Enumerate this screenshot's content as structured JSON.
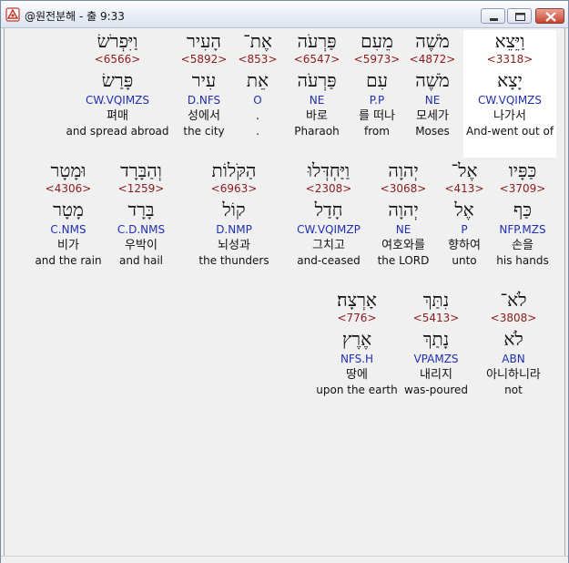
{
  "window": {
    "title": "@원전분해 - 출 9:33"
  },
  "rows": [
    [
      {
        "heb": "וַיֵּצֵא",
        "strong": "<3318>",
        "lex": "יָצָא",
        "parse": "CW.VQIMZS",
        "kor": "나가서",
        "eng": "And-went out of",
        "highlight": true
      },
      {
        "heb": "מֹשֶׁה",
        "strong": "<4872>",
        "lex": "מֹשֶׁה",
        "parse": "NE",
        "kor": "모세가",
        "eng": "Moses"
      },
      {
        "heb": "מֵעִם",
        "strong": "<5973>",
        "lex": "עִם",
        "parse": "P.P",
        "kor": "를 떠나",
        "eng": "from"
      },
      {
        "heb": "פַּרְעֹה",
        "strong": "<6547>",
        "lex": "פַּרְעֹה",
        "parse": "NE",
        "kor": "바로",
        "eng": "Pharaoh"
      },
      {
        "heb": "אֶת־",
        "strong": "<853>",
        "lex": "אֵת",
        "parse": "O",
        "kor": ".",
        "eng": "."
      },
      {
        "heb": "הָעִיר",
        "strong": "<5892>",
        "lex": "עִיר",
        "parse": "D.NFS",
        "kor": "성에서",
        "eng": "the city"
      },
      {
        "heb": "וַיִּפְרֹשׂ",
        "strong": "<6566>",
        "lex": "פָּרַשׂ",
        "parse": "CW.VQIMZS",
        "kor": "펴매",
        "eng": "and spread abroad"
      }
    ],
    [
      {
        "heb": "כַּפָּיו",
        "strong": "<3709>",
        "lex": "כַּף",
        "parse": "NFP.MZS",
        "kor": "손을",
        "eng": "his hands"
      },
      {
        "heb": "אֶל־",
        "strong": "<413>",
        "lex": "אֶל",
        "parse": "P",
        "kor": "향하여",
        "eng": "unto"
      },
      {
        "heb": "יְהוָה",
        "strong": "<3068>",
        "lex": "יְהוָה",
        "parse": "NE",
        "kor": "여호와를",
        "eng": "the LORD"
      },
      {
        "heb": "וַיַּחְדְּלוּ",
        "strong": "<2308>",
        "lex": "חָדַל",
        "parse": "CW.VQIMZP",
        "kor": "그치고",
        "eng": "and-ceased"
      },
      {
        "heb": "הַקֹּלוֹת",
        "strong": "<6963>",
        "lex": "קוֹל",
        "parse": "D.NMP",
        "kor": "뇌성과",
        "eng": "the thunders"
      },
      {
        "heb": "וְהַבָּרָד",
        "strong": "<1259>",
        "lex": "בָּרָד",
        "parse": "C.D.NMS",
        "kor": "우박이",
        "eng": "and hail"
      },
      {
        "heb": "וּמָטָר",
        "strong": "<4306>",
        "lex": "מָטָר",
        "parse": "C.NMS",
        "kor": "비가",
        "eng": "and the rain"
      }
    ],
    [
      {
        "heb": "לֹא־",
        "strong": "<3808>",
        "lex": "לֹא",
        "parse": "ABN",
        "kor": "아니하니라",
        "eng": "not"
      },
      {
        "heb": "נִתַּךְ",
        "strong": "<5413>",
        "lex": "נָתַךְ",
        "parse": "VPAMZS",
        "kor": "내리지",
        "eng": "was-poured"
      },
      {
        "heb": "אָרְצָה׃",
        "strong": "<776>",
        "lex": "אֶרֶץ",
        "parse": "NFS.H",
        "kor": "땅에",
        "eng": "upon the earth"
      }
    ]
  ]
}
